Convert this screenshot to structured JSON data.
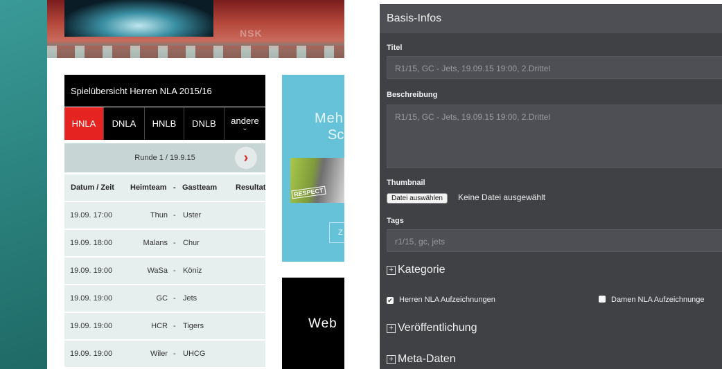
{
  "website": {
    "hero_text": "NSK",
    "schedule_title": "Spielübersicht Herren NLA 2015/16",
    "tabs": [
      {
        "label": "HNLA",
        "active": true
      },
      {
        "label": "DNLA",
        "active": false
      },
      {
        "label": "HNLB",
        "active": false
      },
      {
        "label": "DNLB",
        "active": false
      },
      {
        "label": "andere",
        "active": false
      }
    ],
    "more_chevron": "⌄",
    "round_label": "Runde 1 / 19.9.15",
    "next_arrow": "›",
    "columns": {
      "date": "Datum / Zeit",
      "home": "Heimteam",
      "dash": "-",
      "away": "Gastteam",
      "result": "Resultat"
    },
    "games": [
      {
        "date": "19.09. 17:00",
        "home": "Thun",
        "away": "Uster"
      },
      {
        "date": "19.09. 18:00",
        "home": "Malans",
        "away": "Chur"
      },
      {
        "date": "19.09. 19:00",
        "home": "WaSa",
        "away": "Köniz"
      },
      {
        "date": "19.09. 19:00",
        "home": "GC",
        "away": "Jets"
      },
      {
        "date": "19.09. 19:00",
        "home": "HCR",
        "away": "Tigers"
      },
      {
        "date": "19.09. 19:00",
        "home": "Wiler",
        "away": "UHCG"
      }
    ],
    "ad_blue": {
      "line1": "Meh",
      "line2": "Sc",
      "badge": "RESPECT",
      "button": "Z"
    },
    "ad_black": {
      "text": "Web"
    }
  },
  "admin": {
    "header": "Basis-Infos",
    "title_label": "Titel",
    "title_value": "R1/15, GC - Jets, 19.09.15 19:00, 2.Drittel",
    "description_label": "Beschreibung",
    "description_value": "R1/15, GC - Jets, 19.09.15 19:00, 2.Drittel",
    "thumbnail_label": "Thumbnail",
    "file_button": "Datei auswählen",
    "file_status": "Keine Datei ausgewählt",
    "tags_label": "Tags",
    "tags_value": "r1/15, gc, jets",
    "sections": {
      "category": "Kategorie",
      "publication": "Veröffentlichung",
      "meta": "Meta-Daten"
    },
    "plus_glyph": "+",
    "checkboxes": [
      {
        "label": "Herren NLA Aufzeichnungen",
        "checked": true
      },
      {
        "label": "Damen NLA Aufzeichnunge",
        "checked": false
      }
    ]
  }
}
